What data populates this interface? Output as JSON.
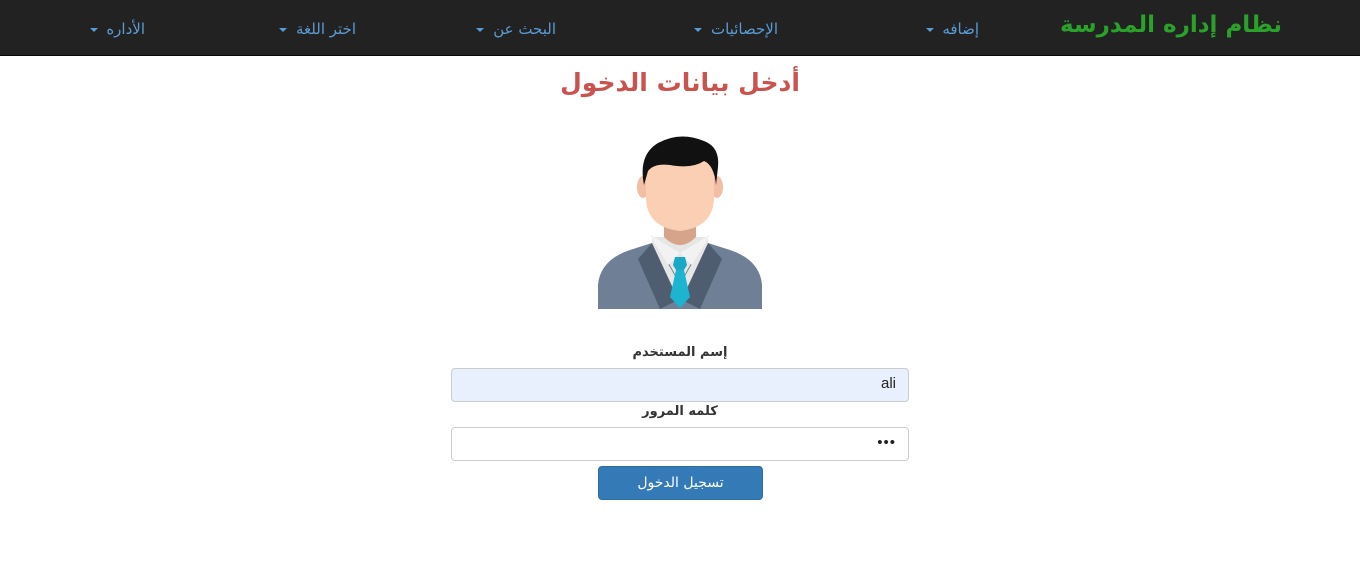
{
  "navbar": {
    "brand": "نظام إداره المدرسة",
    "items": [
      {
        "label": "إضافه"
      },
      {
        "label": "الإحصائيات"
      },
      {
        "label": "البحث عن"
      },
      {
        "label": "اختر اللغة"
      },
      {
        "label": "الأداره"
      }
    ]
  },
  "page": {
    "title": "أدخل بيانات الدخول"
  },
  "form": {
    "username_label": "إسم المستخدم",
    "username_value": "ali",
    "password_label": "كلمه المرور",
    "password_value": "•••",
    "submit_label": "تسجيل الدخول"
  },
  "colors": {
    "navbar_bg": "#222222",
    "brand": "#2aa22a",
    "nav_link": "#5b9bd5",
    "title": "#c9534f",
    "button": "#337ab7"
  },
  "icons": {
    "avatar": "user-avatar-illustration"
  }
}
